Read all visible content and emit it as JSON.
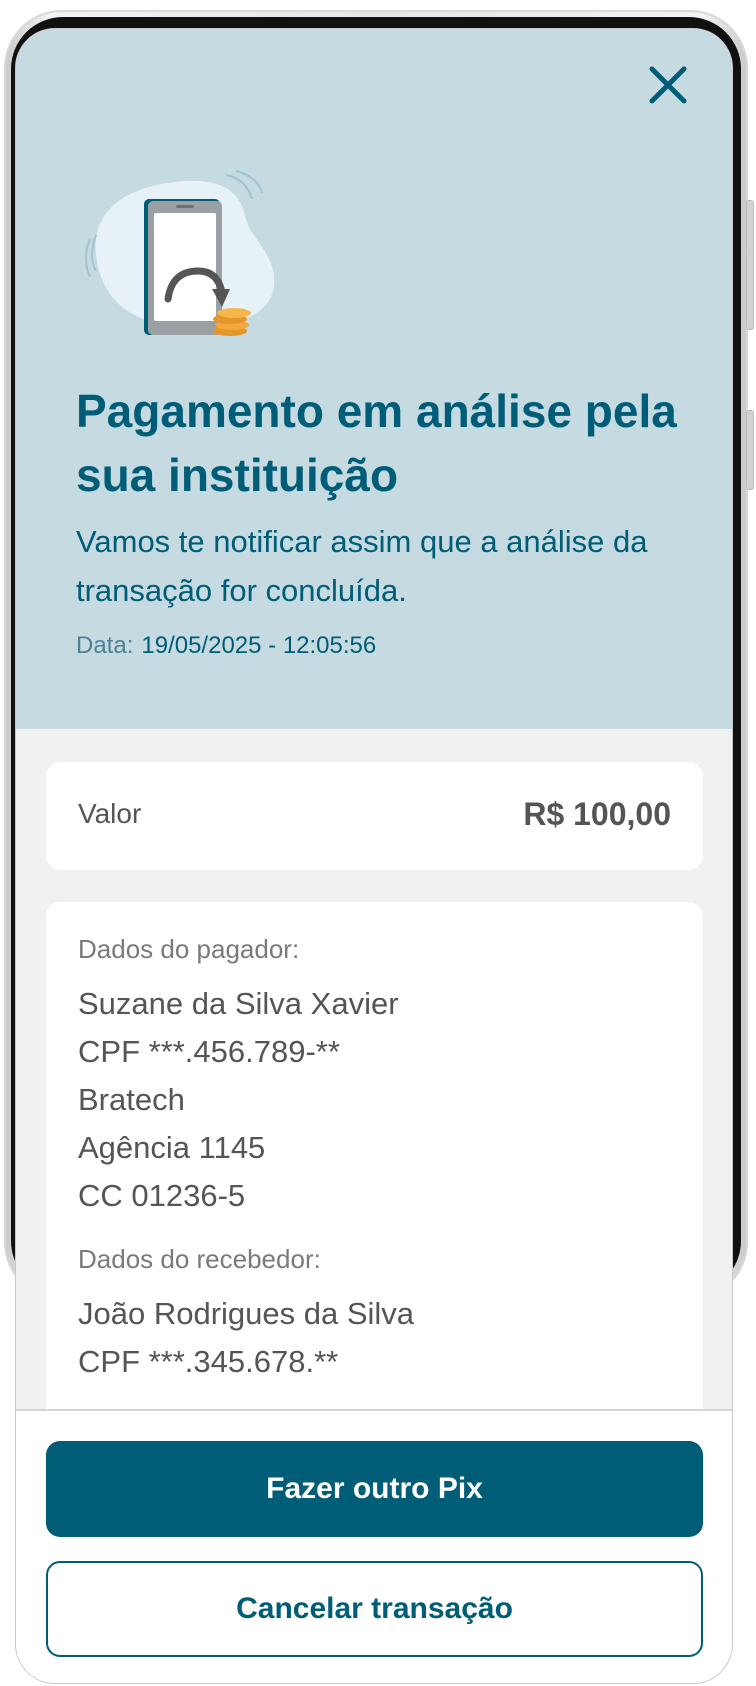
{
  "header": {
    "close_icon": "close-icon",
    "illustration_icon": "phone-payment-illustration"
  },
  "status": {
    "title": "Pagamento em análise pela sua instituição",
    "subtitle": "Vamos te notificar assim que a análise da transação for concluída.",
    "date_label": "Data:",
    "date_value": "19/05/2025 - 12:05:56"
  },
  "amount": {
    "label": "Valor",
    "value": "R$ 100,00"
  },
  "payer": {
    "label": "Dados do pagador:",
    "name": "Suzane da Silva Xavier",
    "cpf": "CPF ***.456.789-**",
    "bank": "Bratech",
    "agency": "Agência 1145",
    "account": "CC 01236-5"
  },
  "receiver": {
    "label": "Dados do recebedor:",
    "name": "João Rodrigues da Silva",
    "cpf": "CPF ***.345.678.**"
  },
  "actions": {
    "primary_label": "Fazer outro Pix",
    "secondary_label": "Cancelar transação"
  },
  "colors": {
    "brand": "#005d77",
    "hero_background": "#c6dae2",
    "page_background": "#f1f1f1",
    "text_gray": "#555555"
  }
}
